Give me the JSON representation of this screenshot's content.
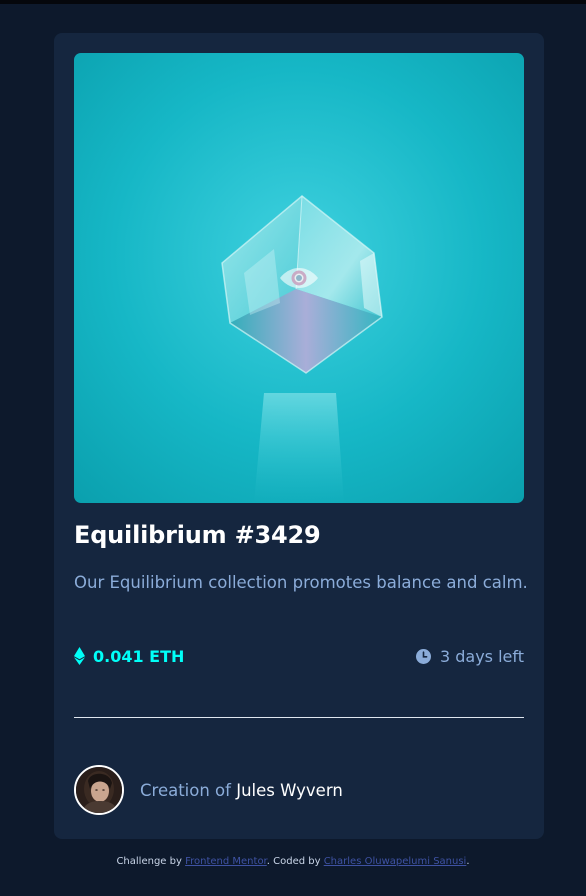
{
  "card": {
    "image_alt": "Equilibrium cube",
    "title": "Equilibrium #3429",
    "description": "Our Equilibrium collection promotes balance and calm.",
    "price": "0.041 ETH",
    "time_left": "3 days left",
    "creator_prefix": "Creation of",
    "creator_name": "Jules Wyvern"
  },
  "attribution": {
    "prefix": "Challenge by",
    "link1": "Frontend Mentor",
    "middle": ". Coded by",
    "link2": "Charles Oluwapelumi Sanusi",
    "suffix": "."
  },
  "icons": {
    "view": "eye-icon",
    "price": "ethereum-icon",
    "time": "clock-icon"
  },
  "colors": {
    "page_bg": "#0d192c",
    "card_bg": "#15263f",
    "cyan": "#00fff8",
    "soft_blue": "#8bacd9",
    "white": "#ffffff",
    "link": "#3e52a3"
  }
}
